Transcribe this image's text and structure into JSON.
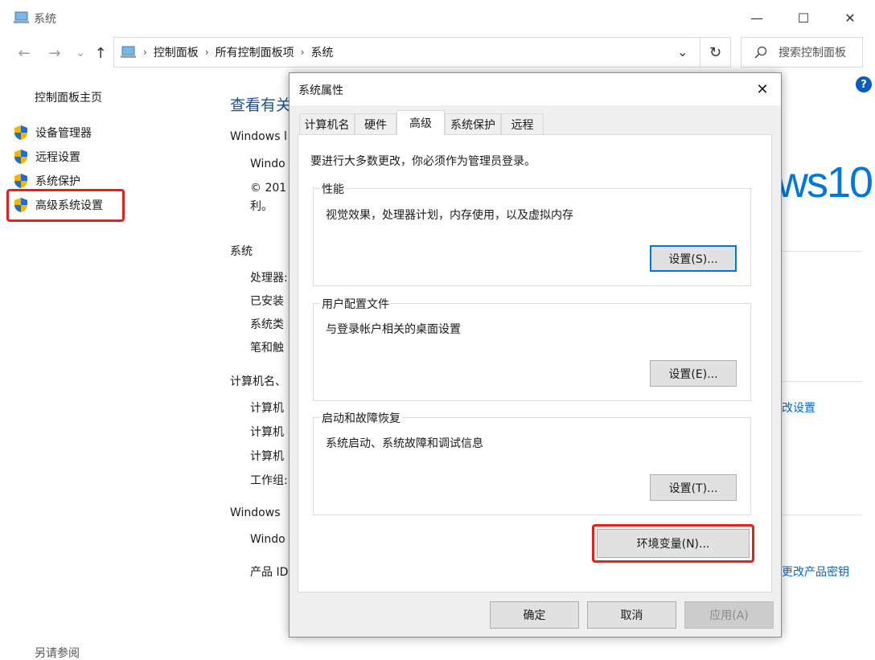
{
  "window": {
    "title": "系统",
    "minimize_glyph": "—",
    "maximize_glyph": "☐",
    "close_glyph": "✕"
  },
  "address_bar": {
    "back_glyph": "←",
    "forward_glyph": "→",
    "history_glyph": "⌄",
    "up_glyph": "↑",
    "crumbs": [
      "控制面板",
      "所有控制面板项",
      "系统"
    ],
    "dropdown_glyph": "⌄",
    "refresh_glyph": "↻",
    "search_placeholder": "搜索控制面板"
  },
  "sidebar": {
    "home": "控制面板主页",
    "items": [
      {
        "label": "设备管理器"
      },
      {
        "label": "远程设置"
      },
      {
        "label": "系统保护"
      },
      {
        "label": "高级系统设置"
      }
    ],
    "see_also": "另请参阅"
  },
  "background": {
    "title": "查看有关",
    "section_windows": "Windows l",
    "windo_line": "Windo",
    "copyright": "© 201",
    "copyright_suffix": "利。",
    "logo": "ws10",
    "section_system": "系统",
    "system_rows": [
      "处理器:",
      "已安装",
      "系统类",
      "笔和触"
    ],
    "section_computer": "计算机名、",
    "computer_rows": [
      "计算机",
      "计算机",
      "计算机",
      "工作组:"
    ],
    "change_settings_link": "改设置",
    "section_activation": "Windows",
    "windo_line2": "Windo",
    "product_id": "产品 ID",
    "change_key_link": "更改产品密钥",
    "help_glyph": "?"
  },
  "dialog": {
    "title": "系统属性",
    "close_glyph": "✕",
    "tabs": [
      {
        "label": "计算机名"
      },
      {
        "label": "硬件"
      },
      {
        "label": "高级"
      },
      {
        "label": "系统保护"
      },
      {
        "label": "远程"
      }
    ],
    "active_tab": "高级",
    "admin_note": "要进行大多数更改，你必须作为管理员登录。",
    "groups": [
      {
        "label": "性能",
        "desc": "视觉效果，处理器计划，内存使用，以及虚拟内存",
        "button": "设置(S)..."
      },
      {
        "label": "用户配置文件",
        "desc": "与登录帐户相关的桌面设置",
        "button": "设置(E)..."
      },
      {
        "label": "启动和故障恢复",
        "desc": "系统启动、系统故障和调试信息",
        "button": "设置(T)..."
      }
    ],
    "env_button": "环境变量(N)...",
    "ok_button": "确定",
    "cancel_button": "取消",
    "apply_button": "应用(A)"
  },
  "colors": {
    "highlight_red": "#e8201a",
    "link_blue": "#0066cc",
    "win_blue": "#0078d7"
  }
}
